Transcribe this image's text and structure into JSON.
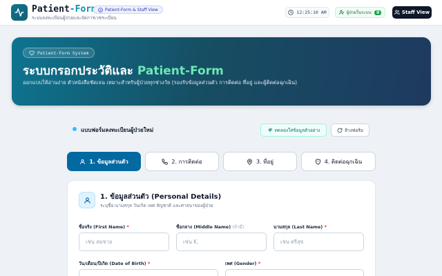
{
  "header": {
    "brand_main": "Patient",
    "brand_dash": "-",
    "brand_accent": "Form",
    "subtitle": "ระบบลงทะเบียนผู้ป่วยและจัดการเวชระเบียน",
    "staff_pill": "Patient-Form & Staff View",
    "clock": "12:25:10 AM",
    "online_label": "ผู้ป่วยในระบบ:",
    "online_count": "0",
    "staff_view_button": "Staff View"
  },
  "hero": {
    "badge": "Patient-Form System",
    "title_prefix": "ระบบกรอกประวัติและ ",
    "title_highlight": "Patient-Form",
    "description": "ออกแบบให้อ่านง่าย ตัวหนังสือชัดเจน เหมาะสำหรับผู้ป่วยทุกช่วงวัย (รองรับข้อมูลส่วนตัว การติดต่อ ที่อยู่ และผู้ติดต่อฉุกเฉิน)"
  },
  "toolbar": {
    "title": "แบบฟอร์มลงทะเบียนผู้ป่วยใหม่",
    "sample_button": "ทดลองใส่ข้อมูลตัวอย่าง",
    "clear_button": "ล้างฟอร์ม"
  },
  "steps": [
    {
      "label": "1. ข้อมูลส่วนตัว",
      "icon": "user-icon"
    },
    {
      "label": "2. การติดต่อ",
      "icon": "phone-icon"
    },
    {
      "label": "3. ที่อยู่",
      "icon": "map-pin-icon"
    },
    {
      "label": "4. ติดต่อฉุกเฉิน",
      "icon": "shield-icon"
    }
  ],
  "section": {
    "title": "1. ข้อมูลส่วนตัว (Personal Details)",
    "subtitle": "ระบุชื่อ-นามสกุล วันเกิด เพศ สัญชาติ และศาสนาของผู้ป่วย"
  },
  "fields": {
    "first_name_label": "ชื่อจริง (First Name)",
    "first_name_placeholder": "เช่น สมชาย",
    "middle_name_label": "ชื่อกลาง (Middle Name)",
    "middle_name_optional": "(ถ้ามี)",
    "middle_name_placeholder": "เช่น K.",
    "last_name_label": "นามสกุล (Last Name)",
    "last_name_placeholder": "เช่น ศรีสุข",
    "dob_label": "วัน/เดือน/ปีเกิด (Date of Birth)",
    "gender_label": "เพศ (Gender)",
    "required_mark": "*"
  },
  "colors": {
    "accent": "#0891b2",
    "active_step": "#0369a1",
    "hero_highlight": "#6ee7b7",
    "dark_button": "#0f172a"
  }
}
